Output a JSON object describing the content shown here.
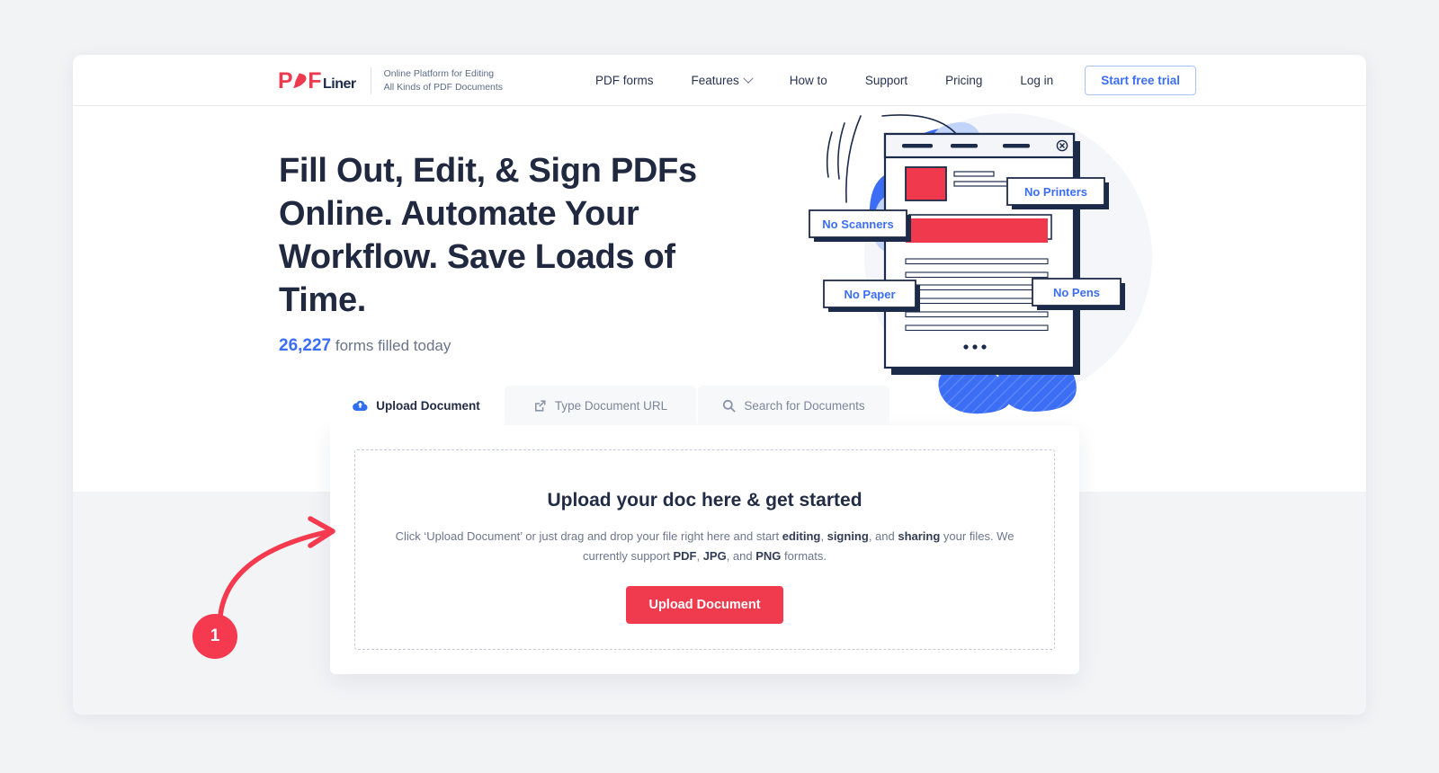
{
  "brand": {
    "logo_p": "P",
    "logo_f": "F",
    "logo_word": "Liner",
    "tagline_line1": "Online Platform for Editing",
    "tagline_line2": "All Kinds of PDF Documents",
    "accent_red": "#ed3a4f",
    "accent_blue": "#3b6ef5",
    "heading_navy": "#20293f"
  },
  "nav": {
    "items": [
      {
        "label": "PDF forms",
        "has_caret": false
      },
      {
        "label": "Features",
        "has_caret": true
      },
      {
        "label": "How to",
        "has_caret": false
      },
      {
        "label": "Support",
        "has_caret": false
      },
      {
        "label": "Pricing",
        "has_caret": false
      },
      {
        "label": "Log in",
        "has_caret": false
      }
    ],
    "cta_label": "Start free trial"
  },
  "hero": {
    "heading": "Fill Out, Edit, & Sign PDFs Online. Automate Your Workflow. Save Loads of Time.",
    "counter_value": "26,227",
    "counter_suffix": "forms filled today"
  },
  "illustration": {
    "labels": [
      {
        "text": "No Scanners"
      },
      {
        "text": "No Printers"
      },
      {
        "text": "No Paper"
      },
      {
        "text": "No Pens"
      }
    ],
    "close_icon": "circled-x-icon",
    "ellipsis": "•••",
    "colors": {
      "blue_blob": "#3b6ef5",
      "light_blue_blob": "#c3d4fb",
      "red_block": "#f0394d",
      "outline_navy": "#1d2b4a"
    }
  },
  "upload_widget": {
    "tabs": [
      {
        "label": "Upload Document",
        "icon": "cloud-upload-icon",
        "active": true
      },
      {
        "label": "Type Document URL",
        "icon": "external-link-icon",
        "active": false
      },
      {
        "label": "Search for Documents",
        "icon": "search-icon",
        "active": false
      }
    ],
    "dropzone": {
      "title": "Upload your doc here & get started",
      "desc_1": "Click ‘Upload Document’ or just drag and drop your file right here and start ",
      "desc_b1": "editing",
      "desc_2": ", ",
      "desc_b2": "signing",
      "desc_3": ", and ",
      "desc_b3": "sharing",
      "desc_4": " your files. We currently support ",
      "desc_b4": "PDF",
      "desc_5": ", ",
      "desc_b5": "JPG",
      "desc_6": ", and ",
      "desc_b6": "PNG",
      "desc_7": " formats.",
      "button_label": "Upload Document"
    }
  },
  "annotation": {
    "step_number": "1",
    "arrow_color": "#f5394e"
  }
}
